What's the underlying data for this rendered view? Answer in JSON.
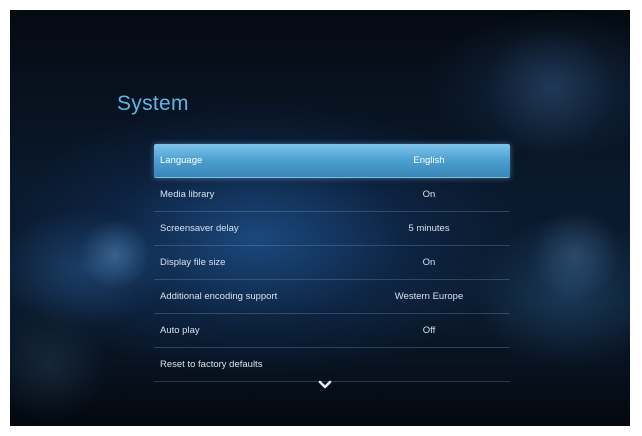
{
  "screen": {
    "title": "System"
  },
  "menu": {
    "items": [
      {
        "label": "Language",
        "value": "English",
        "selected": true
      },
      {
        "label": "Media library",
        "value": "On"
      },
      {
        "label": "Screensaver delay",
        "value": "5 minutes"
      },
      {
        "label": "Display file size",
        "value": "On"
      },
      {
        "label": "Additional encoding support",
        "value": "Western Europe"
      },
      {
        "label": "Auto play",
        "value": "Off"
      },
      {
        "label": "Reset to factory defaults",
        "value": ""
      }
    ]
  },
  "icons": {
    "scroll_down": "chevron-down-icon"
  },
  "colors": {
    "title": "#5fb6ea",
    "selection": "#4b9fcf",
    "text": "#d6e2ee"
  }
}
